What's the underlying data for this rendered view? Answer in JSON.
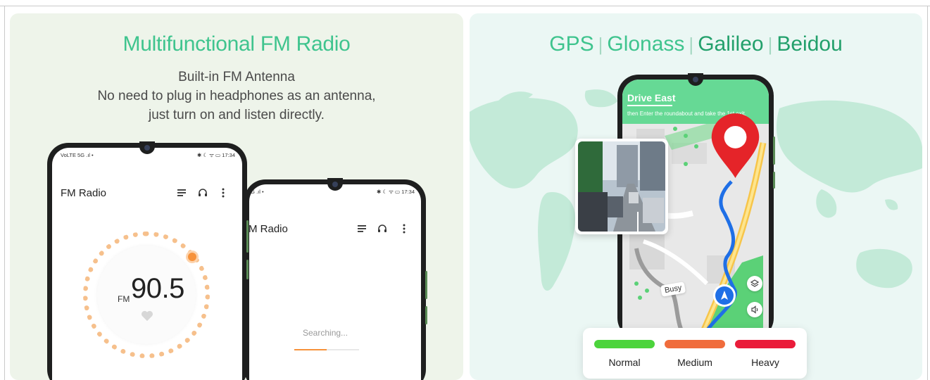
{
  "fm_panel": {
    "heading": "Multifunctional FM Radio",
    "subtitle_lines": [
      "Built-in FM Antenna",
      "No need to plug in headphones as an antenna,",
      "just turn on and listen directly."
    ],
    "phone_front": {
      "status_left": "VoLTE 5G .ıl  •",
      "status_right": "✱ ☾ ᯤ ▭ 17:34",
      "app_title": "FM Radio",
      "frequency_unit": "FM",
      "frequency": "90.5",
      "icons": [
        "list-icon",
        "headphones-icon",
        "more-vertical-icon",
        "heart-icon"
      ]
    },
    "phone_back": {
      "status_left": "5G .ıl  •",
      "status_right": "✱ ☾ ᯤ ▭ 17:34",
      "app_title": "M Radio",
      "searching_text": "Searching...",
      "search_progress": 0.5
    }
  },
  "gps_panel": {
    "title_parts": [
      "GPS",
      "Glonass",
      "Galileo",
      "Beidou"
    ],
    "nav": {
      "title": "Drive East",
      "instruction": "then Enter  the roundabout and take the 1st exit."
    },
    "busy_label": "Busy",
    "legend": [
      {
        "label": "Normal",
        "color": "#4cd43c"
      },
      {
        "label": "Medium",
        "color": "#f06c3c"
      },
      {
        "label": "Heavy",
        "color": "#ea1c3a"
      }
    ],
    "colors": {
      "accent": "#3fc48e",
      "accent_dark": "#22a06b",
      "route": "#1f6fe6",
      "pin": "#e52429",
      "map_land": "#c3ead8"
    },
    "icons": [
      "location-pin-icon",
      "navigation-arrow-icon",
      "layers-icon",
      "volume-icon"
    ]
  }
}
